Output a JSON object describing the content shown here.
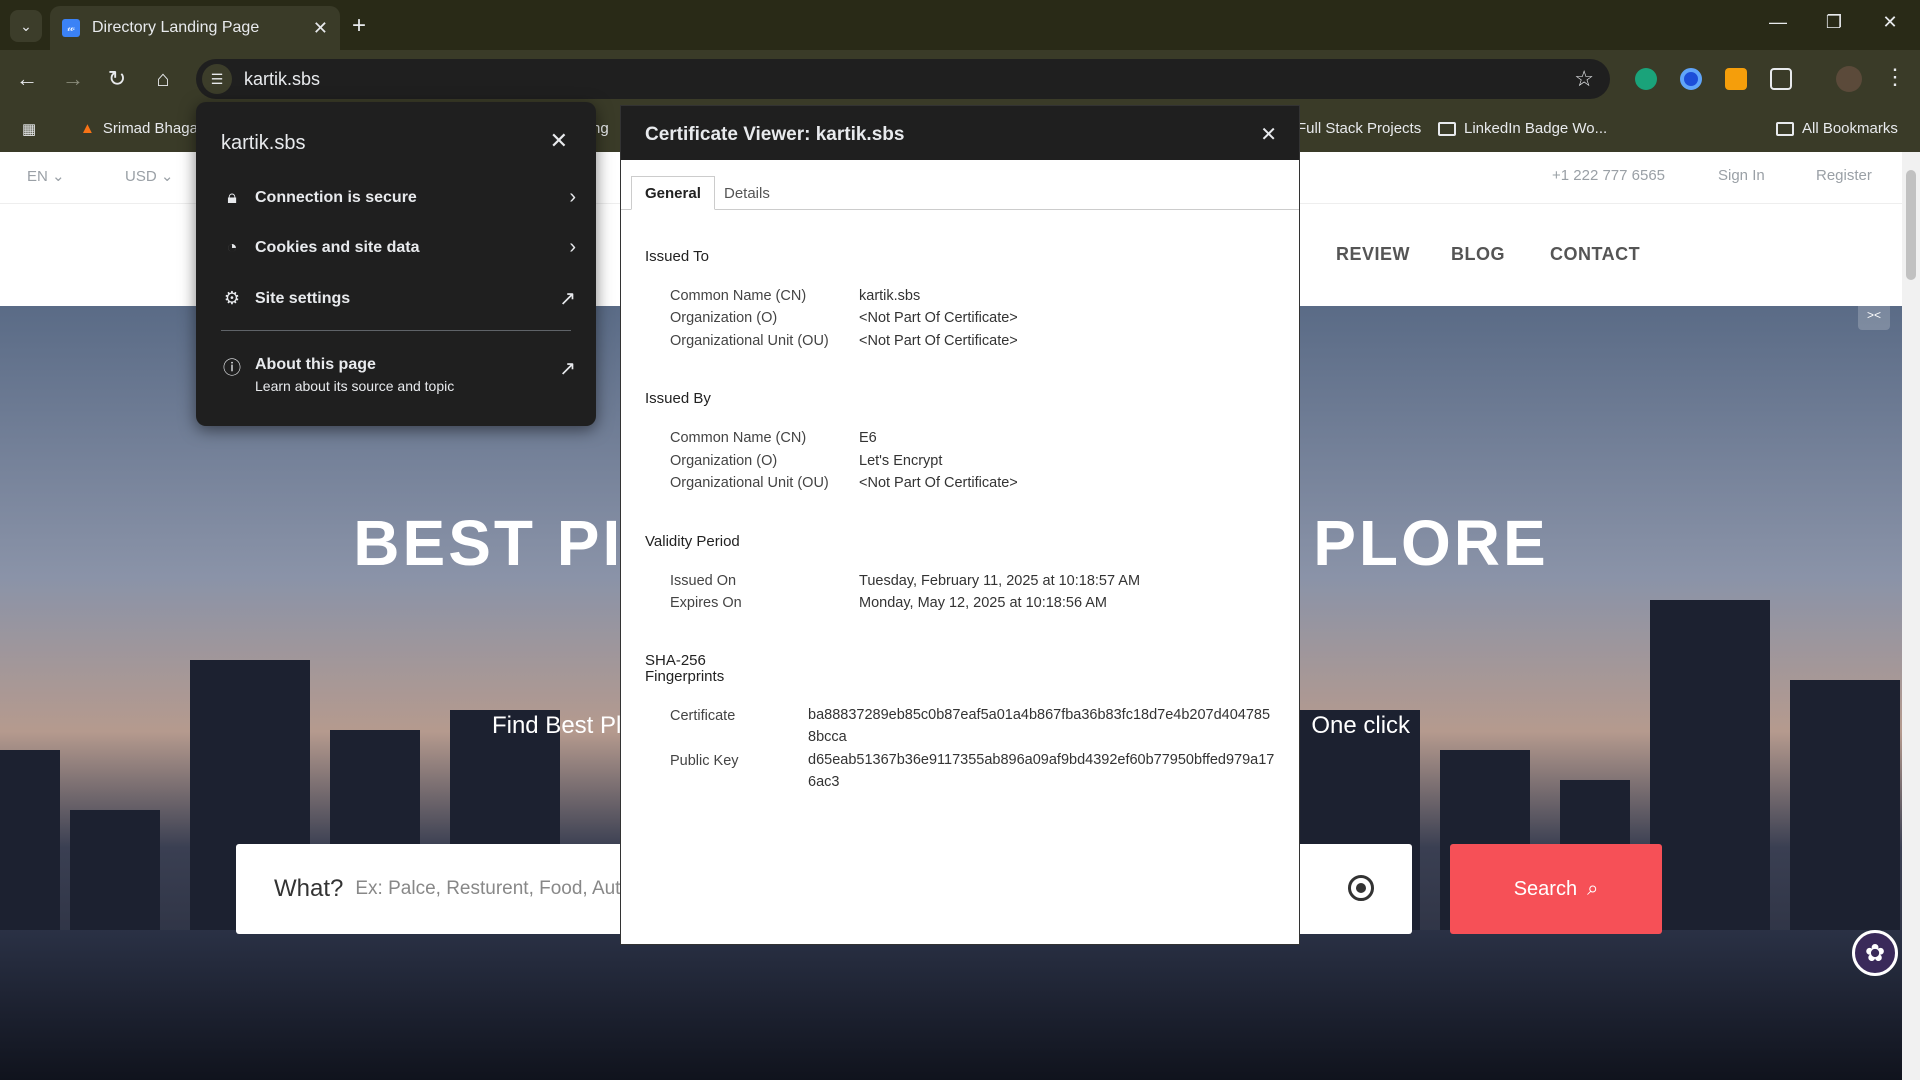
{
  "browser": {
    "tab_title": "Directory Landing Page",
    "tab_favicon": "𝓌",
    "url": "kartik.sbs",
    "window_controls": [
      "—",
      "❐",
      "✕"
    ],
    "bookmarks": [
      {
        "label": "Srimad Bhaga"
      },
      {
        "label": "ng"
      },
      {
        "label": "Full Stack Projects"
      },
      {
        "label": "LinkedIn Badge Wo..."
      },
      {
        "label": "All Bookmarks"
      }
    ]
  },
  "site": {
    "topbar": {
      "lang": "EN",
      "currency": "USD",
      "phone": "+1 222 777 6565",
      "sign_in": "Sign In",
      "register": "Register"
    },
    "nav": [
      "REVIEW",
      "BLOG",
      "CONTACT"
    ],
    "hero": {
      "title_left": "BEST PI",
      "title_right": "PLORE",
      "sub_left": "Find Best Pl",
      "sub_right": "One click"
    },
    "search": {
      "label": "What?",
      "placeholder": "Ex: Palce, Resturent, Food, Aut",
      "button": "Search"
    }
  },
  "site_info_popup": {
    "title": "kartik.sbs",
    "items": [
      {
        "label": "Connection is secure",
        "icon": "lock-icon"
      },
      {
        "label": "Cookies and site data",
        "icon": "cookie-icon"
      },
      {
        "label": "Site settings",
        "icon": "gear-icon"
      }
    ],
    "about": {
      "label": "About this page",
      "sub": "Learn about its source and topic"
    }
  },
  "certificate": {
    "title": "Certificate Viewer: kartik.sbs",
    "tabs": [
      "General",
      "Details"
    ],
    "issued_to": {
      "heading": "Issued To",
      "rows": [
        {
          "k": "Common Name (CN)",
          "v": "kartik.sbs"
        },
        {
          "k": "Organization (O)",
          "v": "<Not Part Of Certificate>"
        },
        {
          "k": "Organizational Unit (OU)",
          "v": "<Not Part Of Certificate>"
        }
      ]
    },
    "issued_by": {
      "heading": "Issued By",
      "rows": [
        {
          "k": "Common Name (CN)",
          "v": "E6"
        },
        {
          "k": "Organization (O)",
          "v": "Let's Encrypt"
        },
        {
          "k": "Organizational Unit (OU)",
          "v": "<Not Part Of Certificate>"
        }
      ]
    },
    "validity": {
      "heading": "Validity Period",
      "rows": [
        {
          "k": "Issued On",
          "v": "Tuesday, February 11, 2025 at 10:18:57 AM"
        },
        {
          "k": "Expires On",
          "v": "Monday, May 12, 2025 at 10:18:56 AM"
        }
      ]
    },
    "fingerprints": {
      "heading_1": "SHA-256",
      "heading_2": "Fingerprints",
      "rows": [
        {
          "k": "Certificate",
          "v": "ba88837289eb85c0b87eaf5a01a4b867fba36b83fc18d7e4b207d4047858bcca"
        },
        {
          "k": "Public Key",
          "v": "d65eab51367b36e9117355ab896a09af9bd4392ef60b77950bffed979a176ac3"
        }
      ]
    }
  },
  "colors": {
    "accent": "#f65057",
    "chrome_bg": "#3a3b28",
    "popup_bg": "#1f1f1f"
  }
}
